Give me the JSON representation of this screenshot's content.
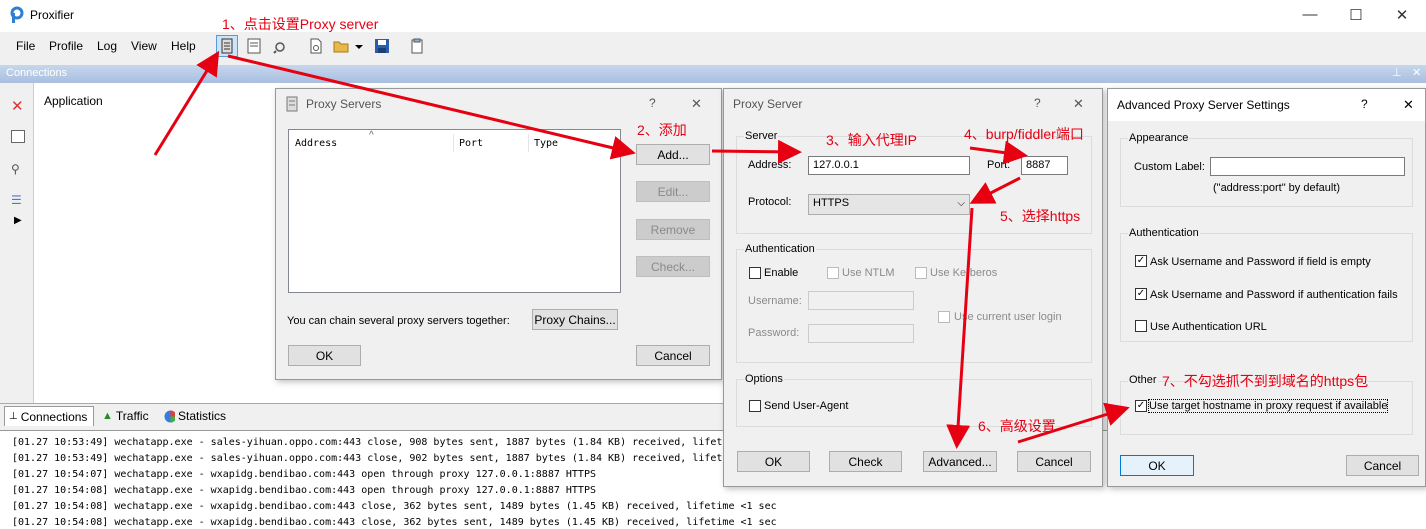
{
  "window": {
    "title": "Proxifier",
    "controls": {
      "minimize": "—",
      "maximize": "☐",
      "close": "✕"
    }
  },
  "menu": [
    "File",
    "Profile",
    "Log",
    "View",
    "Help"
  ],
  "connections": {
    "header": "Connections",
    "column_application": "Application"
  },
  "tabs": [
    "Connections",
    "Traffic",
    "Statistics"
  ],
  "log": [
    "[01.27 10:53:49] wechatapp.exe - sales-yihuan.oppo.com:443 close, 908 bytes sent, 1887 bytes (1.84 KB) received, lifeti",
    "[01.27 10:53:49] wechatapp.exe - sales-yihuan.oppo.com:443 close, 902 bytes sent, 1887 bytes (1.84 KB) received, lifeti",
    "[01.27 10:54:07] wechatapp.exe - wxapidg.bendibao.com:443 open through proxy 127.0.0.1:8887 HTTPS",
    "[01.27 10:54:08] wechatapp.exe - wxapidg.bendibao.com:443 open through proxy 127.0.0.1:8887 HTTPS",
    "[01.27 10:54:08] wechatapp.exe - wxapidg.bendibao.com:443 close, 362 bytes sent, 1489 bytes (1.45 KB) received, lifetime <1 sec",
    "[01.27 10:54:08] wechatapp.exe - wxapidg.bendibao.com:443 close, 362 bytes sent, 1489 bytes (1.45 KB) received, lifetime <1 sec"
  ],
  "proxy_servers": {
    "title": "Proxy Servers",
    "help": "?",
    "close": "✕",
    "columns": [
      "Address",
      "Port",
      "Type"
    ],
    "sort_glyph": "^",
    "add": "Add...",
    "edit": "Edit...",
    "remove": "Remove",
    "check": "Check...",
    "chain_text": "You can chain several proxy servers together:",
    "proxy_chains": "Proxy Chains...",
    "ok": "OK",
    "cancel": "Cancel"
  },
  "proxy_server": {
    "title": "Proxy Server",
    "help": "?",
    "close": "✕",
    "server_group": "Server",
    "address_label": "Address:",
    "address_value": "127.0.0.1",
    "port_label": "Port:",
    "port_value": "8887",
    "protocol_label": "Protocol:",
    "protocol_value": "HTTPS",
    "auth_group": "Authentication",
    "enable": "Enable",
    "use_ntlm": "Use NTLM",
    "use_kerberos": "Use Kerberos",
    "username_label": "Username:",
    "password_label": "Password:",
    "use_current_user": "Use current user login",
    "options_group": "Options",
    "send_user_agent": "Send User-Agent",
    "ok": "OK",
    "check": "Check",
    "advanced": "Advanced...",
    "cancel": "Cancel"
  },
  "advanced": {
    "title": "Advanced Proxy Server Settings",
    "help": "?",
    "close": "✕",
    "appearance_group": "Appearance",
    "custom_label": "Custom Label:",
    "custom_hint": "(\"address:port\" by default)",
    "auth_group": "Authentication",
    "ask_if_empty": "Ask Username and Password if field is empty",
    "ask_if_fails": "Ask Username and Password if authentication fails",
    "use_auth_url": "Use Authentication URL",
    "other_group": "Other",
    "use_target_hostname": "Use target hostname in proxy request if available",
    "ok": "OK",
    "cancel": "Cancel"
  },
  "annotations": {
    "a1": "1、点击设置Proxy server",
    "a2": "2、添加",
    "a3": "3、输入代理IP",
    "a4": "4、burp/fiddler端口",
    "a5": "5、选择https",
    "a6": "6、高级设置",
    "a7": "7、不勾选抓不到到域名的https包"
  },
  "colors": {
    "annotation": "#e60012",
    "accent": "#0078d7",
    "header": "#a9bfe0"
  }
}
